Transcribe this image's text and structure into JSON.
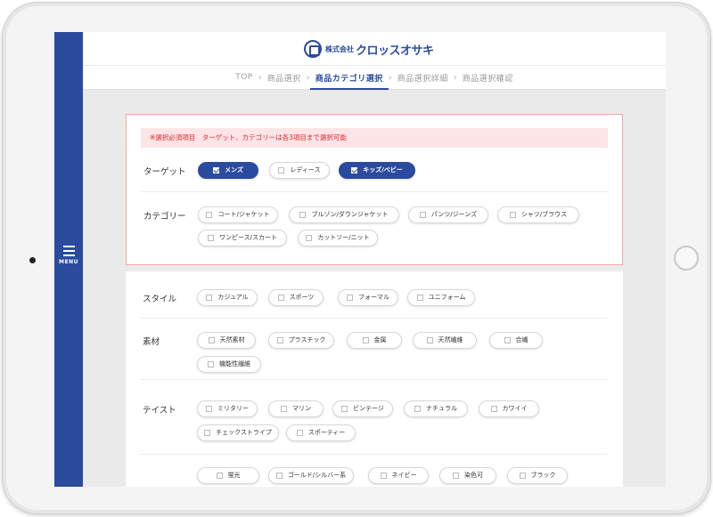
{
  "header": {
    "logo_small": "株式会社",
    "logo_name": "クロッスオサキ"
  },
  "sidebar": {
    "menu_label": "MENU"
  },
  "breadcrumb": {
    "items": [
      "TOP",
      "商品選択",
      "商品カテゴリ選択",
      "商品選択詳細",
      "商品選択確認"
    ],
    "active_index": 2
  },
  "required": {
    "notice": "※選択必須項目　ターゲット、カテゴリーは各3項目まで選択可能",
    "target": {
      "label": "ターゲット",
      "options": [
        {
          "label": "メンズ",
          "checked": true
        },
        {
          "label": "レディース",
          "checked": false
        },
        {
          "label": "キッズ/ベビー",
          "checked": true
        }
      ]
    },
    "category": {
      "label": "カテゴリー",
      "options": [
        {
          "label": "コート/ジャケット",
          "checked": false
        },
        {
          "label": "ブルゾン/ダウンジャケット",
          "checked": false
        },
        {
          "label": "パンツ/ジーンズ",
          "checked": false
        },
        {
          "label": "シャツ/ブラウス",
          "checked": false
        },
        {
          "label": "ワンピース/スカート",
          "checked": false
        },
        {
          "label": "カットソー/ニット",
          "checked": false
        }
      ]
    }
  },
  "optional": {
    "style": {
      "label": "スタイル",
      "options": [
        {
          "label": "カジュアル",
          "checked": false
        },
        {
          "label": "スポーツ",
          "checked": false
        },
        {
          "label": "フォーマル",
          "checked": false
        },
        {
          "label": "ユニフォーム",
          "checked": false
        }
      ]
    },
    "material": {
      "label": "素材",
      "options": [
        {
          "label": "天然素材",
          "checked": false
        },
        {
          "label": "プラスチック",
          "checked": false
        },
        {
          "label": "金属",
          "checked": false
        },
        {
          "label": "天然繊維",
          "checked": false
        },
        {
          "label": "合繊",
          "checked": false
        },
        {
          "label": "機能性繊維",
          "checked": false
        }
      ]
    },
    "taste": {
      "label": "テイスト",
      "options": [
        {
          "label": "ミリタリー",
          "checked": false
        },
        {
          "label": "マリン",
          "checked": false
        },
        {
          "label": "ビンテージ",
          "checked": false
        },
        {
          "label": "ナチュラル",
          "checked": false
        },
        {
          "label": "カワイイ",
          "checked": false
        },
        {
          "label": "チェックストライプ",
          "checked": false
        },
        {
          "label": "スポーティー",
          "checked": false
        }
      ]
    },
    "other": {
      "label": "",
      "options": [
        {
          "label": "蛍光",
          "checked": false
        },
        {
          "label": "ゴールド/シルバー系",
          "checked": false
        },
        {
          "label": "ネイビー",
          "checked": false
        },
        {
          "label": "染色可",
          "checked": false
        },
        {
          "label": "ブラック",
          "checked": false
        }
      ]
    }
  },
  "colors": {
    "brand_blue": "#2b4b9e",
    "notice_bg": "#fde4e6",
    "notice_text": "#e0242f",
    "required_border": "#f3a7a7"
  }
}
